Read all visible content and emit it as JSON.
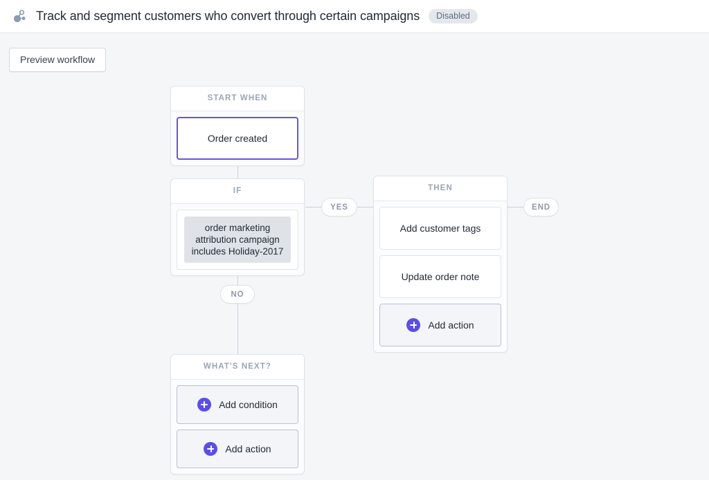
{
  "header": {
    "icon": "workflow-nodes-icon",
    "title": "Track and segment customers who convert through certain campaigns",
    "status_badge": "Disabled"
  },
  "toolbar": {
    "preview_label": "Preview workflow"
  },
  "colors": {
    "accent_purple": "#5c4ee5",
    "selected_border": "#6b55d6",
    "canvas_bg": "#f4f6f8",
    "muted_text": "#9aa5b4",
    "condition_bg": "#dfe3e8"
  },
  "flow": {
    "start_node": {
      "header": "START WHEN",
      "trigger": "Order created"
    },
    "if_node": {
      "header": "IF",
      "condition": "order marketing attribution campaign includes Holiday-2017"
    },
    "then_node": {
      "header": "THEN",
      "actions": [
        "Add customer tags",
        "Update order note"
      ],
      "add_action_label": "Add action",
      "add_icon": "plus-circle-icon"
    },
    "next_node": {
      "header": "WHAT'S NEXT?",
      "buttons": [
        {
          "label": "Add condition",
          "icon": "plus-circle-icon"
        },
        {
          "label": "Add action",
          "icon": "plus-circle-icon"
        }
      ]
    },
    "connectors": {
      "yes": "YES",
      "no": "NO",
      "end": "END"
    }
  }
}
